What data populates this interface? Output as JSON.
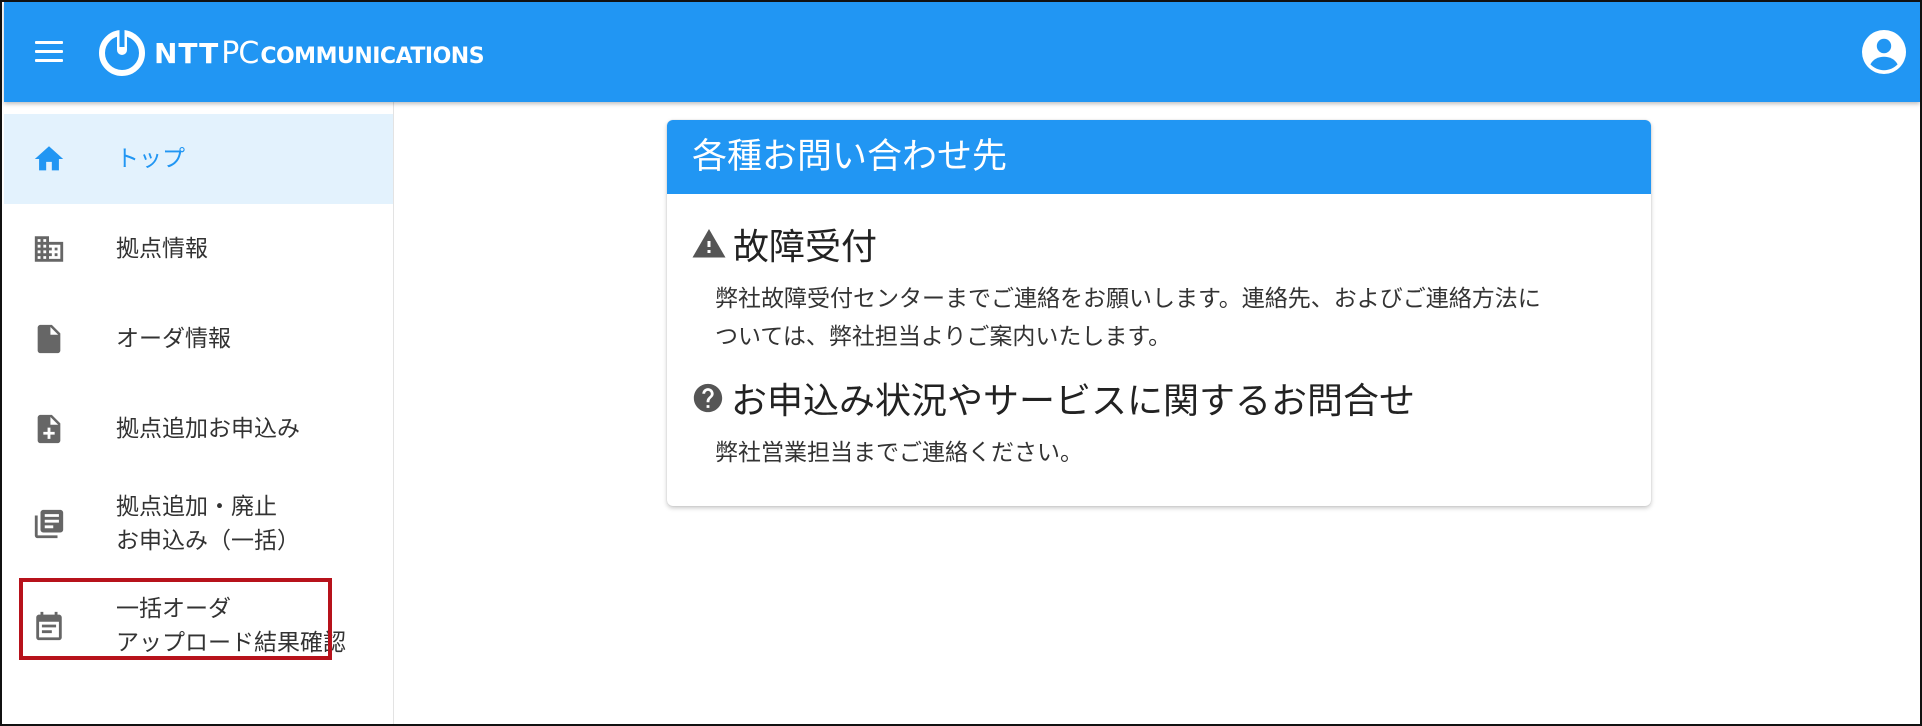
{
  "header": {
    "logo": {
      "ntt": "NTT",
      "pc": "PC",
      "communications": "COMMUNICATIONS"
    },
    "icons": {
      "menu": "menu-icon",
      "account": "account-circle-icon"
    },
    "background_color": "#2196f3"
  },
  "sidebar": {
    "items": [
      {
        "label": "トップ",
        "icon": "home-icon",
        "active": true
      },
      {
        "label": "拠点情報",
        "icon": "building-icon",
        "active": false
      },
      {
        "label": "オーダ情報",
        "icon": "document-icon",
        "active": false
      },
      {
        "label": "拠点追加お申込み",
        "icon": "document-plus-icon",
        "active": false
      },
      {
        "lines": [
          "拠点追加・廃止",
          "お申込み（一括）"
        ],
        "icon": "library-books-icon",
        "active": false,
        "highlighted": true
      },
      {
        "lines": [
          "一括オーダ",
          "アップロード結果確認"
        ],
        "icon": "calendar-text-icon",
        "active": false
      }
    ],
    "active_color": "#2196f3",
    "active_background": "#e3f2fd",
    "highlight_color": "#b7121b"
  },
  "card": {
    "title": "各種お問い合わせ先",
    "sections": [
      {
        "icon": "warning-icon",
        "title": "故障受付",
        "body_lines": [
          "弊社故障受付センターまでご連絡をお願いします。連絡先、およびご連絡方法に",
          "ついては、弊社担当よりご案内いたします。"
        ]
      },
      {
        "icon": "help-circle-icon",
        "title": "お申込み状況やサービスに関するお問合せ",
        "body_lines": [
          "弊社営業担当までご連絡ください。"
        ]
      }
    ]
  }
}
